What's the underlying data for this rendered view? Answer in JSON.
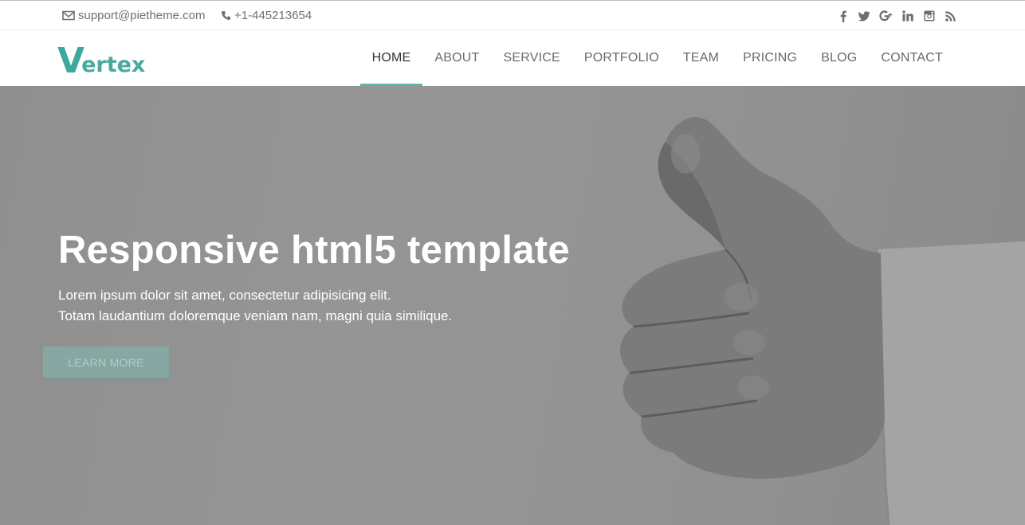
{
  "topbar": {
    "email": "support@pietheme.com",
    "phone": "+1-445213654",
    "social": [
      {
        "icon": "facebook-icon",
        "glyph": "f"
      },
      {
        "icon": "twitter-icon",
        "glyph": "t"
      },
      {
        "icon": "google-plus-icon",
        "glyph": "g+"
      },
      {
        "icon": "linkedin-icon",
        "glyph": "in"
      },
      {
        "icon": "instagram-icon",
        "glyph": "ig"
      },
      {
        "icon": "rss-icon",
        "glyph": "rss"
      }
    ]
  },
  "nav": {
    "logo_first": "V",
    "logo_rest": "ertex",
    "items": [
      {
        "label": "HOME",
        "active": true
      },
      {
        "label": "ABOUT"
      },
      {
        "label": "SERVICE"
      },
      {
        "label": "PORTFOLIO"
      },
      {
        "label": "TEAM"
      },
      {
        "label": "PRICING"
      },
      {
        "label": "BLOG"
      },
      {
        "label": "CONTACT"
      }
    ]
  },
  "hero": {
    "title": "Responsive html5 template",
    "line1": "Lorem ipsum dolor sit amet, consectetur adipisicing elit.",
    "line2": "Totam laudantium doloremque veniam nam, magni quia similique.",
    "button": "LEARN MORE"
  },
  "colors": {
    "accent": "#57b7ac",
    "hero_bg": "#929292"
  }
}
